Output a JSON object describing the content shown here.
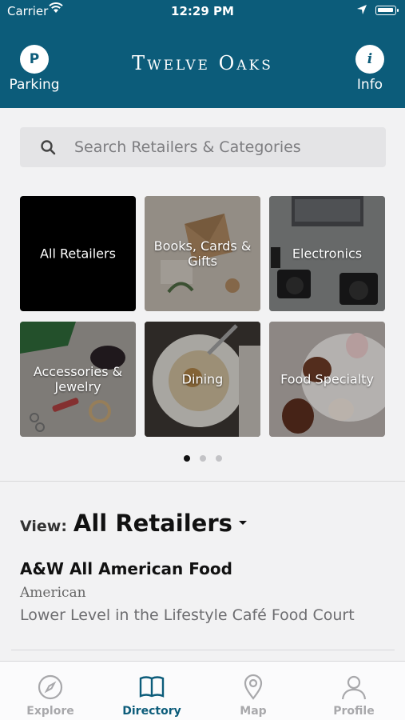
{
  "status_bar": {
    "carrier": "Carrier",
    "time": "12:29 PM"
  },
  "header": {
    "title": "Twelve Oaks",
    "parking": {
      "icon_letter": "P",
      "label": "Parking"
    },
    "info": {
      "icon_letter": "i",
      "label": "Info"
    },
    "background_color": "#0c5c7a"
  },
  "search": {
    "placeholder": "Search Retailers & Categories",
    "value": ""
  },
  "categories": [
    {
      "label": "All Retailers"
    },
    {
      "label": "Books, Cards & Gifts"
    },
    {
      "label": "Electronics"
    },
    {
      "label": "Accessories & Jewelry"
    },
    {
      "label": "Dining"
    },
    {
      "label": "Food Specialty"
    }
  ],
  "pagination": {
    "pages": 3,
    "current": 1
  },
  "view": {
    "label": "View:",
    "value": "All Retailers"
  },
  "stores": [
    {
      "name": "A&W All American Food",
      "category": "American",
      "location": "Lower Level in the Lifestyle Café Food Court"
    }
  ],
  "tabs": [
    {
      "label": "Explore",
      "icon": "compass-icon",
      "active": false
    },
    {
      "label": "Directory",
      "icon": "book-icon",
      "active": true
    },
    {
      "label": "Map",
      "icon": "map-pin-icon",
      "active": false
    },
    {
      "label": "Profile",
      "icon": "person-icon",
      "active": false
    }
  ],
  "colors": {
    "accent": "#0c5c7a",
    "inactive_tab": "#a8a8ab"
  }
}
